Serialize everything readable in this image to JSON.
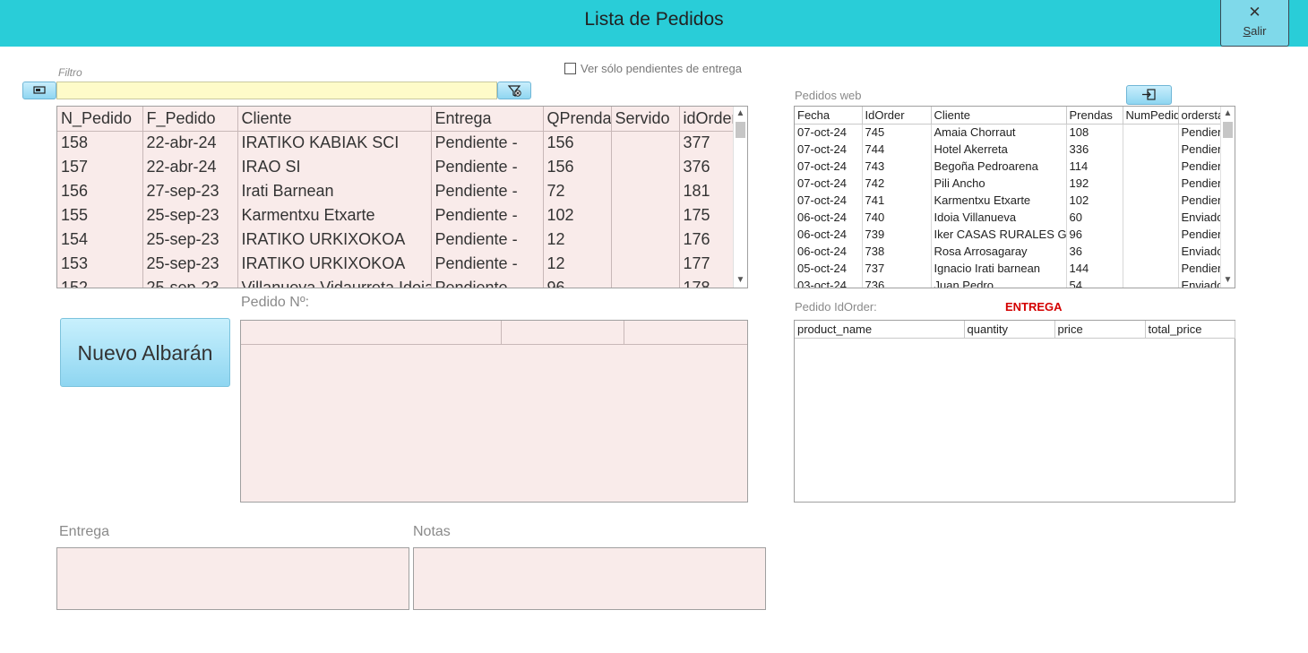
{
  "header": {
    "title": "Lista de Pedidos",
    "close_label": "Salir",
    "close_icon": "✕"
  },
  "filter": {
    "caption": "Filtro",
    "value": "",
    "pending_only_label": "Ver sólo pendientes de entrega",
    "pending_only_checked": false
  },
  "orders": {
    "columns": [
      "N_Pedido",
      "F_Pedido",
      "Cliente",
      "Entrega",
      "QPrenda",
      "Servido",
      "idOrder"
    ],
    "rows": [
      [
        "158",
        "22-abr-24",
        "IRATIKO KABIAK SCI",
        "Pendiente  -",
        "156",
        "",
        "377"
      ],
      [
        "157",
        "22-abr-24",
        "IRAO SI",
        "Pendiente  -",
        "156",
        "",
        "376"
      ],
      [
        "156",
        "27-sep-23",
        "Irati Barnean",
        "Pendiente  -",
        "72",
        "",
        "181"
      ],
      [
        "155",
        "25-sep-23",
        "Karmentxu Etxarte",
        "Pendiente  -",
        "102",
        "",
        "175"
      ],
      [
        "154",
        "25-sep-23",
        "IRATIKO URKIXOKOA",
        "Pendiente  -",
        "12",
        "",
        "176"
      ],
      [
        "153",
        "25-sep-23",
        "IRATIKO URKIXOKOA",
        "Pendiente  -",
        "12",
        "",
        "177"
      ],
      [
        "152",
        "25-sep-23",
        "Villanueva Vidaurreta Idoia",
        "Pendiente  -",
        "96",
        "",
        "178"
      ]
    ]
  },
  "actions": {
    "new_albaran_label": "Nuevo Albarán"
  },
  "detail": {
    "pedido_label": "Pedido Nº:"
  },
  "bottom": {
    "entrega_label": "Entrega",
    "notas_label": "Notas"
  },
  "web": {
    "caption": "Pedidos web",
    "columns": [
      "Fecha",
      "IdOrder",
      "Cliente",
      "Prendas",
      "NumPedido",
      "orderstatus"
    ],
    "rows": [
      [
        "07-oct-24",
        "745",
        "Amaia Chorraut",
        "108",
        "",
        "Pendiente"
      ],
      [
        "07-oct-24",
        "744",
        "Hotel Akerreta",
        "336",
        "",
        "Pendiente"
      ],
      [
        "07-oct-24",
        "743",
        "Begoña Pedroarena",
        "114",
        "",
        "Pendiente"
      ],
      [
        "07-oct-24",
        "742",
        "Pili Ancho",
        "192",
        "",
        "Pendiente"
      ],
      [
        "07-oct-24",
        "741",
        "Karmentxu Etxarte",
        "102",
        "",
        "Pendiente"
      ],
      [
        "06-oct-24",
        "740",
        "Idoia Villanueva",
        "60",
        "",
        "Enviado"
      ],
      [
        "06-oct-24",
        "739",
        "Iker CASAS RURALES GIB",
        "96",
        "",
        "Pendiente"
      ],
      [
        "06-oct-24",
        "738",
        "Rosa Arrosagaray",
        "36",
        "",
        "Enviado"
      ],
      [
        "05-oct-24",
        "737",
        "Ignacio Irati barnean",
        "144",
        "",
        "Pendiente"
      ],
      [
        "03-oct-24",
        "736",
        "Juan Pedro",
        "54",
        "",
        "Enviado"
      ]
    ]
  },
  "order_items": {
    "idorder_label": "Pedido IdOrder:",
    "status": "ENTREGA",
    "status_color": "#d40000",
    "columns": [
      "product_name",
      "quantity",
      "price",
      "total_price"
    ]
  },
  "colors": {
    "header_bg": "#29cdd8",
    "grid_bg": "#f9ebea",
    "filter_bg": "#fefbc9",
    "button_bg": "#8fd6f1"
  }
}
